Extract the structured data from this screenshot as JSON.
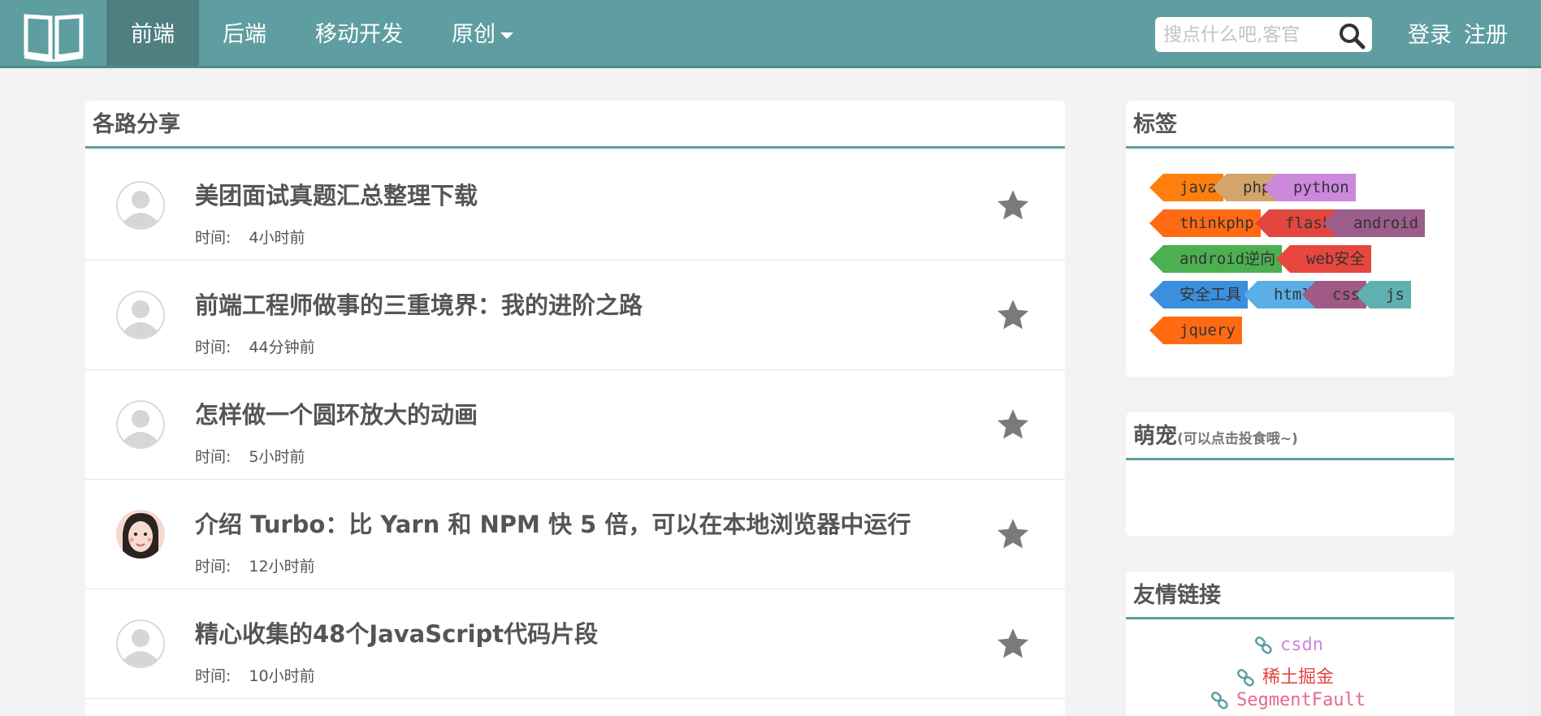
{
  "nav": {
    "logo_icon": "open-book-icon",
    "items": [
      {
        "label": "前端",
        "active": true
      },
      {
        "label": "后端",
        "active": false
      },
      {
        "label": "移动开发",
        "active": false
      },
      {
        "label": "原创",
        "active": false,
        "dropdown": true
      }
    ],
    "search_placeholder": "搜点什么吧,客官",
    "login": "登录",
    "register": "注册"
  },
  "main": {
    "title": "各路分享",
    "time_label": "时间:",
    "articles": [
      {
        "title": "美团面试真题汇总整理下载",
        "time": "4小时前",
        "avatar": "default"
      },
      {
        "title": "前端工程师做事的三重境界：我的进阶之路",
        "time": "44分钟前",
        "avatar": "default"
      },
      {
        "title": "怎样做一个圆环放大的动画",
        "time": "5小时前",
        "avatar": "default"
      },
      {
        "title": "介绍 Turbo：比 Yarn 和 NPM 快 5 倍，可以在本地浏览器中运行",
        "time": "12小时前",
        "avatar": "photo"
      },
      {
        "title": "精心收集的48个JavaScript代码片段",
        "time": "10小时前",
        "avatar": "default"
      }
    ]
  },
  "sidebar": {
    "tags_title": "标签",
    "tags": [
      {
        "label": "java",
        "color": "#ff7f0e"
      },
      {
        "label": "php",
        "color": "#d2a56d"
      },
      {
        "label": "python",
        "color": "#cc88dd"
      },
      {
        "label": "thinkphp",
        "color": "#ff6a13"
      },
      {
        "label": "flask",
        "color": "#e2473f"
      },
      {
        "label": "android",
        "color": "#9b5d8a"
      },
      {
        "label": "android逆向",
        "color": "#4caf50"
      },
      {
        "label": "web安全",
        "color": "#e8473f"
      },
      {
        "label": "安全工具",
        "color": "#3b8fdf"
      },
      {
        "label": "html",
        "color": "#5aaee6"
      },
      {
        "label": "css",
        "color": "#a05a86"
      },
      {
        "label": "js",
        "color": "#5fb0b0"
      },
      {
        "label": "jquery",
        "color": "#ff6a13"
      }
    ],
    "pets_title": "萌宠",
    "pets_subtitle": "(可以点击投食哦~)",
    "links_title": "友情链接",
    "links": [
      {
        "label": "csdn",
        "color": "#cc88dd"
      },
      {
        "label": "稀土掘金",
        "color": "#e2473f"
      },
      {
        "label": "SegmentFault",
        "color": "#e56a8a"
      }
    ]
  },
  "colors": {
    "accent": "#5f9ea0",
    "star": "#7a7a7a"
  }
}
